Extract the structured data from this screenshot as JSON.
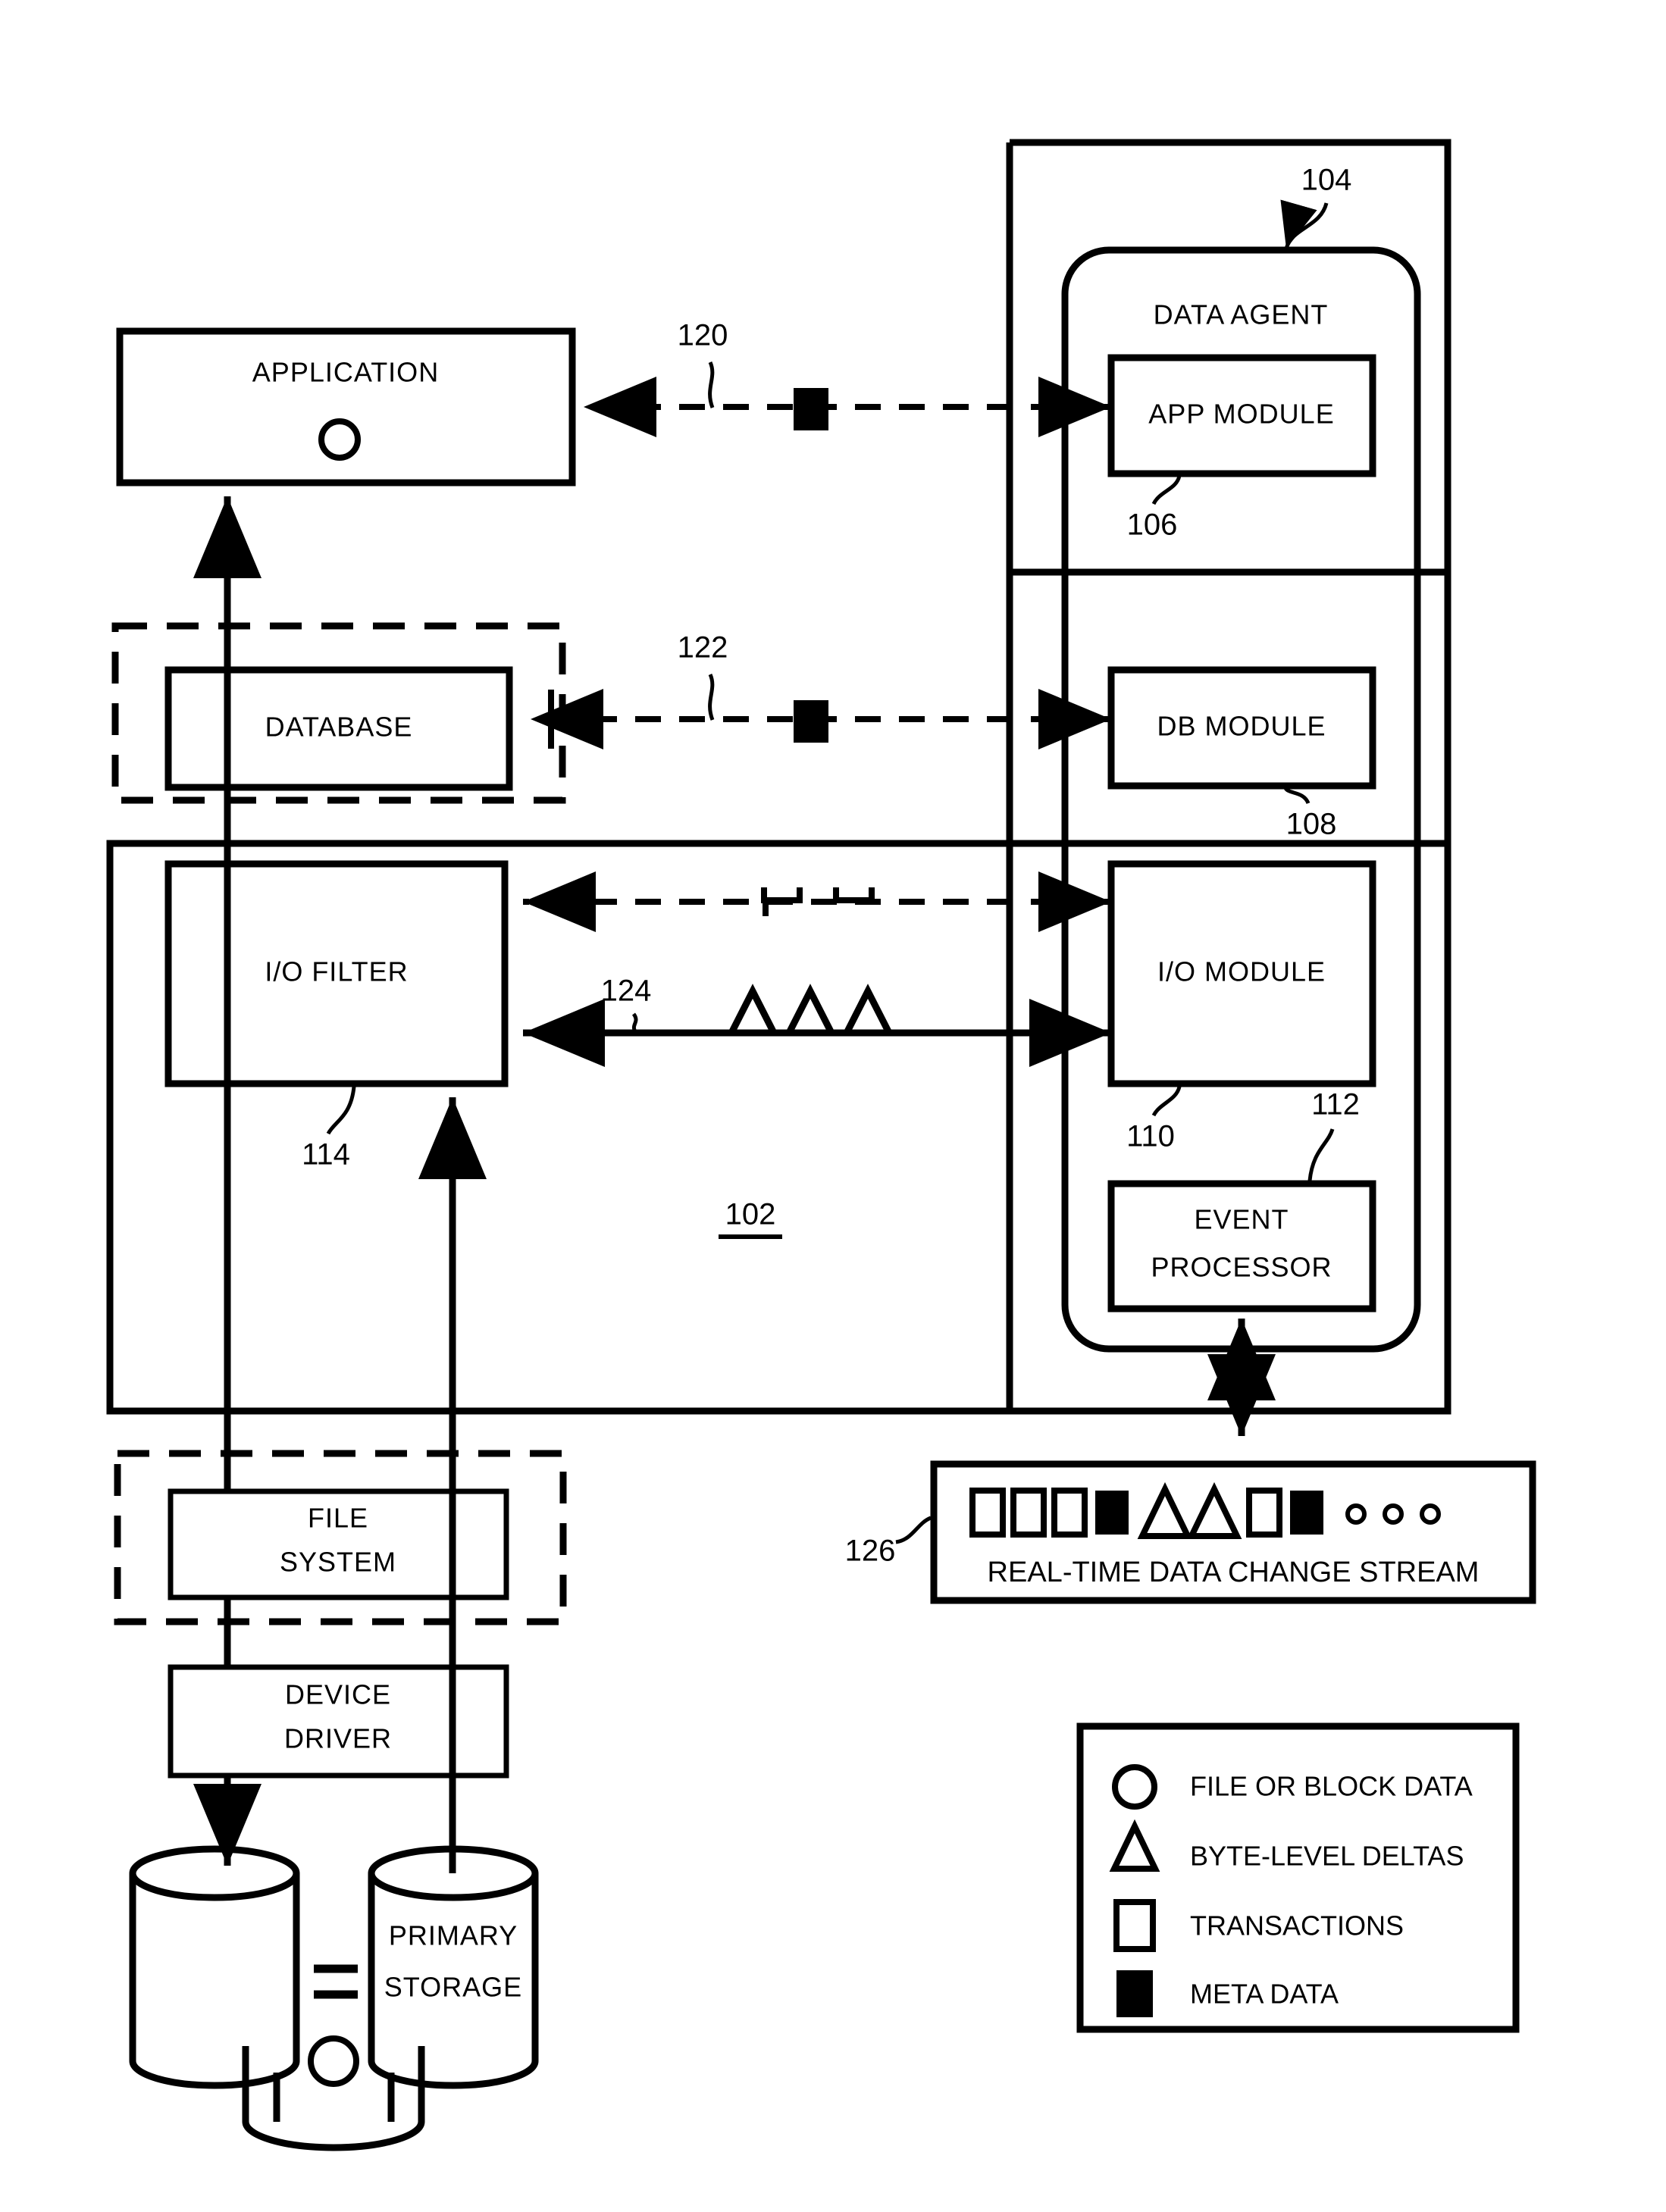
{
  "figure": {
    "type": "patent-block-diagram",
    "background_color": "#ffffff",
    "line_color": "#000000"
  },
  "blocks": {
    "application": {
      "label": "APPLICATION",
      "symbol": "circle"
    },
    "database": {
      "label": "DATABASE"
    },
    "io_filter": {
      "label": "I/O FILTER"
    },
    "file_system": {
      "label_line1": "FILE",
      "label_line2": "SYSTEM"
    },
    "device_driver": {
      "label_line1": "DEVICE",
      "label_line2": "DRIVER"
    },
    "primary_storage": {
      "label_line1": "PRIMARY",
      "label_line2": "STORAGE"
    },
    "secondary_cylinder": {
      "label": ""
    },
    "third_cylinder": {
      "label": "",
      "symbol": "circle"
    },
    "data_agent": {
      "label": "DATA AGENT"
    },
    "app_module": {
      "label": "APP MODULE"
    },
    "db_module": {
      "label": "DB MODULE"
    },
    "io_module": {
      "label": "I/O MODULE"
    },
    "event_processor": {
      "label_line1": "EVENT",
      "label_line2": "PROCESSOR"
    },
    "change_stream": {
      "label": "REAL-TIME DATA CHANGE STREAM"
    }
  },
  "reference_numerals": {
    "system": "102",
    "data_agent": "104",
    "app_module": "106",
    "db_module": "108",
    "io_module": "110",
    "event_processor": "112",
    "io_filter": "114",
    "app_meta_path": "120",
    "db_meta_path": "122",
    "io_delta_path": "124",
    "change_stream": "126"
  },
  "equality_symbol": "=",
  "stream": {
    "items": [
      "transaction",
      "transaction",
      "transaction",
      "metadata",
      "delta",
      "delta",
      "transaction",
      "metadata",
      "dot",
      "dot",
      "dot"
    ]
  },
  "path_markers": {
    "app_path": [
      "metadata"
    ],
    "db_path": [
      "metadata"
    ],
    "io_transaction_path": [
      "transaction",
      "transaction"
    ],
    "io_delta_path": [
      "delta",
      "delta",
      "delta"
    ]
  },
  "legend": {
    "items": [
      {
        "symbol": "circle",
        "label": "FILE OR BLOCK DATA"
      },
      {
        "symbol": "triangle",
        "label": "BYTE-LEVEL DELTAS"
      },
      {
        "symbol": "square-open",
        "label": "TRANSACTIONS"
      },
      {
        "symbol": "square-filled",
        "label": "META DATA"
      }
    ]
  }
}
